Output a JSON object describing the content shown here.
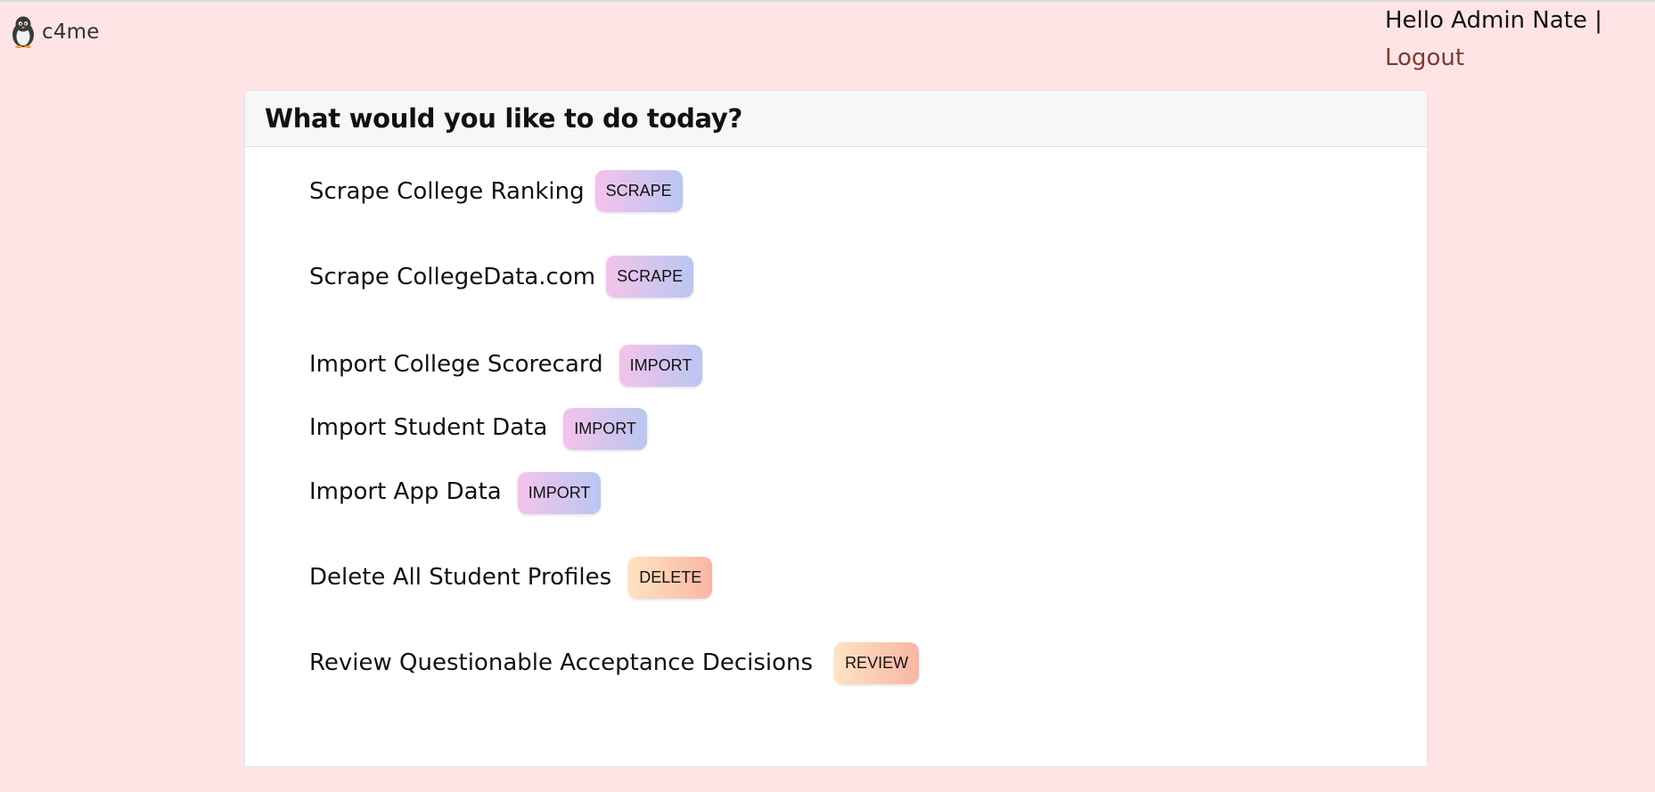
{
  "brand": {
    "name": "c4me",
    "logo_icon": "penguin-icon"
  },
  "user": {
    "greeting": "Hello Admin Nate |",
    "logout_label": "Logout"
  },
  "card": {
    "title": "What would you like to do today?"
  },
  "tasks": [
    {
      "label": "Scrape College Ranking",
      "button": "SCRAPE",
      "style": "purple"
    },
    {
      "label": "Scrape CollegeData.com",
      "button": "SCRAPE",
      "style": "purple"
    },
    {
      "label": "Import College Scorecard",
      "button": "IMPORT",
      "style": "purple"
    },
    {
      "label": "Import Student Data",
      "button": "IMPORT",
      "style": "purple"
    },
    {
      "label": "Import App Data",
      "button": "IMPORT",
      "style": "purple"
    },
    {
      "label": "Delete All Student Profiles",
      "button": "DELETE",
      "style": "peach"
    },
    {
      "label": "Review Questionable Acceptance Decisions",
      "button": "REVIEW",
      "style": "peach"
    }
  ],
  "colors": {
    "page_background": "#ffe4e6",
    "logout_link": "#7a3b32",
    "button_purple_start": "#f4c3ea",
    "button_purple_end": "#b9c6f2",
    "button_peach_start": "#fde3c2",
    "button_peach_end": "#fab6a2"
  }
}
